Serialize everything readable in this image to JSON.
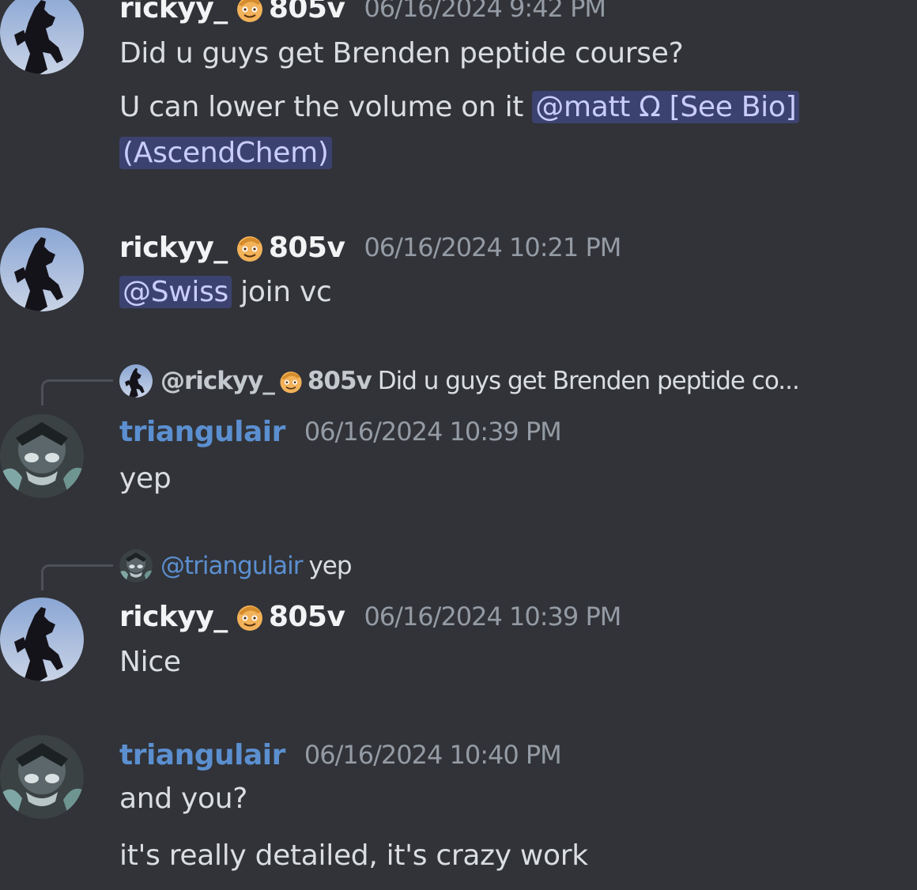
{
  "messages": [
    {
      "username": "rickyy_",
      "tag": "805v",
      "timestamp": "06/16/2024 9:42 PM",
      "lines": [
        "Did u guys get Brenden peptide course?",
        "U can lower the volume on it "
      ],
      "mention_inline": "@matt Ω [See Bio]",
      "mention_wrap": "(AscendChem)"
    },
    {
      "username": "rickyy_",
      "tag": "805v",
      "timestamp": "06/16/2024 10:21 PM",
      "mention": "@Swiss",
      "text": " join vc"
    },
    {
      "reply_to_name": "@rickyy_",
      "reply_to_tag": "805v",
      "reply_to_text": "Did u guys get Brenden peptide co...",
      "username": "triangulair",
      "timestamp": "06/16/2024 10:39 PM",
      "text": "yep"
    },
    {
      "reply_to_name": "@triangulair",
      "reply_to_text": "yep",
      "username": "rickyy_",
      "tag": "805v",
      "timestamp": "06/16/2024 10:39 PM",
      "text": "Nice"
    },
    {
      "username": "triangulair",
      "timestamp": "06/16/2024 10:40 PM",
      "lines": [
        "and you?",
        "it's really detailed, it's crazy work"
      ]
    }
  ],
  "icons": {
    "role_emoji": "smiling-face-with-cap-icon",
    "avatar_rickyy": "horse-silhouette-avatar",
    "avatar_triangulair": "masked-figure-avatar"
  },
  "colors": {
    "background": "#313338",
    "mention_bg": "#3c4270",
    "mention_text": "#c9cdfb",
    "username_blue": "#5b8fd0",
    "timestamp": "#949ba4"
  }
}
